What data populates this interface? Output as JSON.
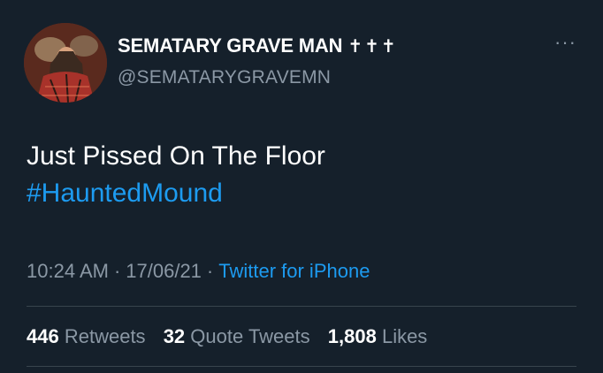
{
  "author": {
    "display_name": "SEMATARY GRAVE MAN",
    "name_emoji": "✝✝✝",
    "handle": "@SEMATARYGRAVEMN",
    "avatar_icon": "avatar-photo"
  },
  "more_icon": "more-options-icon",
  "tweet": {
    "text": "Just Pissed On The Floor",
    "hashtag": "#HauntedMound"
  },
  "meta": {
    "time": "10:24 AM",
    "separator": "·",
    "date": "17/06/21",
    "source": "Twitter for iPhone"
  },
  "stats": {
    "retweets_count": "446",
    "retweets_label": "Retweets",
    "quotes_count": "32",
    "quotes_label": "Quote Tweets",
    "likes_count": "1,808",
    "likes_label": "Likes"
  },
  "colors": {
    "background": "#15202b",
    "link": "#1d9bf0",
    "secondary_text": "#8b98a5",
    "divider": "#38444d"
  }
}
